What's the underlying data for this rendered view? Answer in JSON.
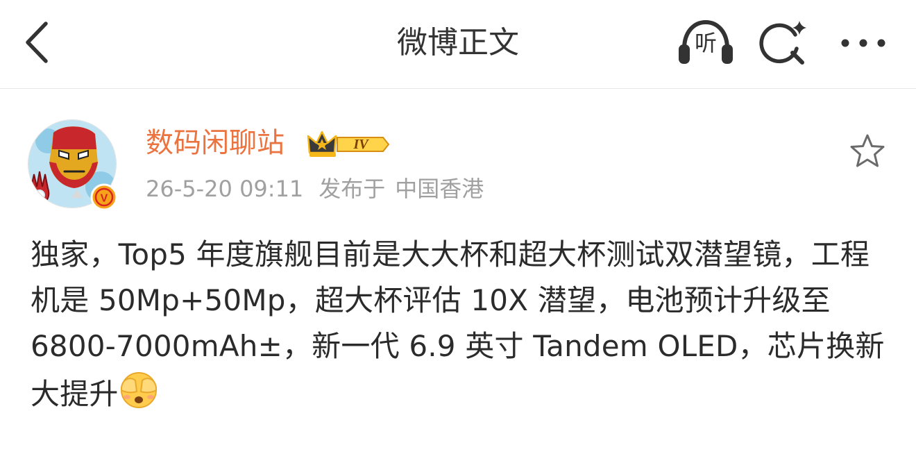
{
  "nav": {
    "title": "微博正文",
    "listen_label": "听",
    "back_icon": "chevron-left-icon",
    "search_icon": "search-sparkle-icon",
    "more_icon": "more-dots-icon"
  },
  "post": {
    "author": {
      "name": "数码闲聊站",
      "level_badge": "IV",
      "verified_badge": "V",
      "avatar_icon": "iron-man-avatar"
    },
    "time": "26-5-20 09:11",
    "published_at_label": "发布于",
    "location": "中国香港",
    "body_text": "独家，Top5 年度旗舰目前是大大杯和超大杯测试双潜望镜，工程机是 50Mp+50Mp，超大杯评估 10X 潜望，电池预计升级至 6800-7000mAh±，新一代 6.9 英寸 Tandem OLED，芯片换新大提升",
    "emoji": "face-covering-eyes-emoji",
    "favorite_icon": "star-outline-icon"
  },
  "colors": {
    "username": "#eb7340",
    "meta": "#a0a0a0",
    "text": "#2b2b2b",
    "crown_gold": "#f5b61a",
    "verified_orange": "#f7a21b"
  }
}
